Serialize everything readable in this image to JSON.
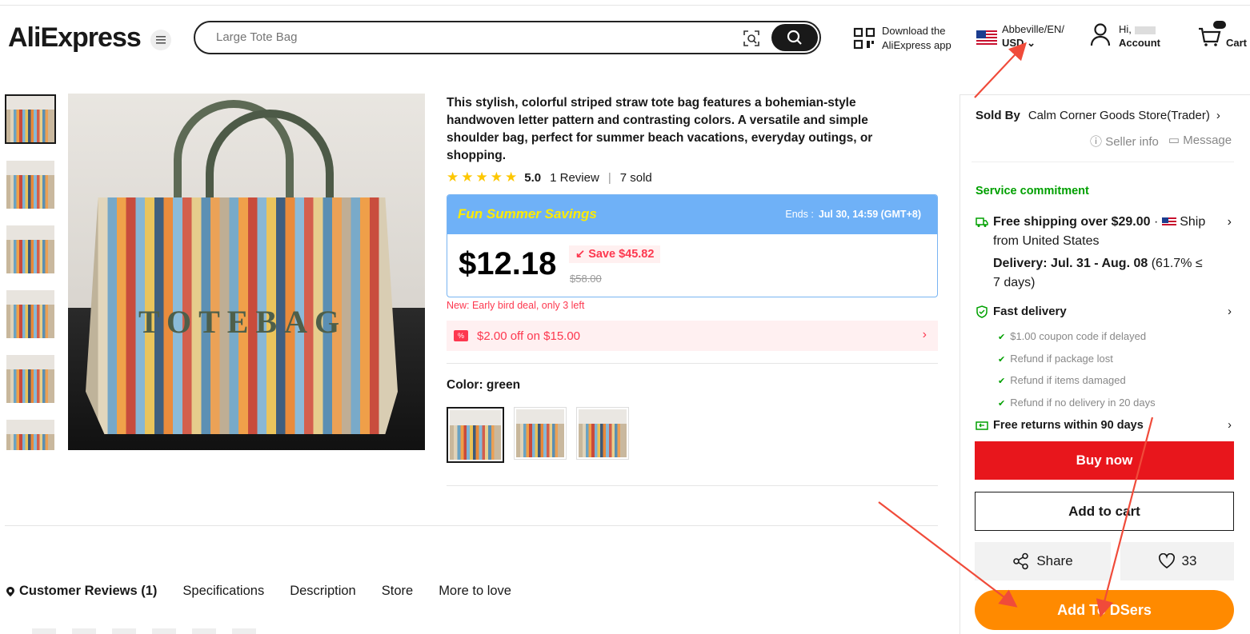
{
  "header": {
    "logo": "AliExpress",
    "search_placeholder": "Large Tote Bag",
    "app_line1": "Download the",
    "app_line2": "AliExpress app",
    "region_line1": "Abbeville/EN/",
    "region_line2": "USD",
    "account_line1": "Hi,",
    "account_line2": "Account",
    "cart_label": "Cart"
  },
  "product": {
    "title": "This stylish, colorful striped straw tote bag features a bohemian-style handwoven letter pattern and contrasting colors. A versatile and simple shoulder bag, perfect for summer beach vacations, everyday outings, or shopping.",
    "bag_text": "TOTEBAG",
    "rating": "5.0",
    "stars": 5,
    "reviews": "1 Review",
    "sold": "7 sold",
    "promo_title": "Fun Summer Savings",
    "ends_label": "Ends :",
    "ends_value": "Jul 30, 14:59 (GMT+8)",
    "price": "$12.18",
    "save": "Save $45.82",
    "original_price": "$58.00",
    "new_deal": "New:  Early bird deal, only 3 left",
    "coupon_badge": "%",
    "coupon": "$2.00 off on $15.00",
    "color_label": "Color: green"
  },
  "tabs": [
    {
      "label": "Customer Reviews (1)"
    },
    {
      "label": "Specifications"
    },
    {
      "label": "Description"
    },
    {
      "label": "Store"
    },
    {
      "label": "More to love"
    }
  ],
  "panel": {
    "sold_by_label": "Sold By",
    "store_name": "Calm Corner Goods Store(Trader)",
    "seller_info": "Seller info",
    "message": "Message",
    "service_commitment": "Service commitment",
    "free_shipping": "Free shipping over $29.00",
    "ship_word": "Ship",
    "ship_from": "from United States",
    "delivery": "Delivery: Jul. 31 - Aug. 08",
    "delivery_extra": "(61.7% ≤",
    "delivery_days": "7 days)",
    "fast_delivery": "Fast delivery",
    "checks": [
      "$1.00 coupon code if delayed",
      "Refund if package lost",
      "Refund if items damaged",
      "Refund if no delivery in 20 days"
    ],
    "free_returns": "Free returns within 90 days",
    "buy_now": "Buy now",
    "add_to_cart": "Add to cart",
    "share": "Share",
    "likes": "33",
    "add_to_dsers": "Add To DSers"
  },
  "colors": {
    "accent_red": "#e8161c",
    "dsers_orange": "#ff8a00",
    "promo_blue": "#6fb1f7",
    "service_green": "#00a000",
    "annotation_arrow": "#f04b3a"
  }
}
